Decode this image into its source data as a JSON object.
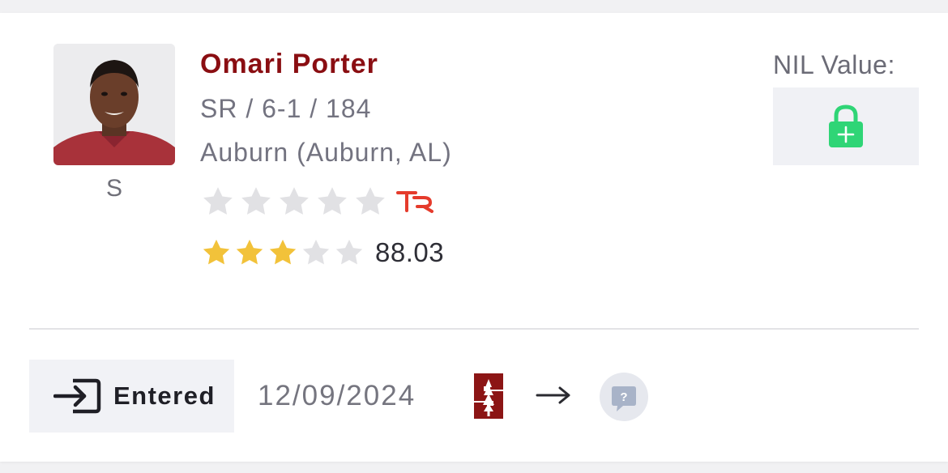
{
  "player": {
    "name": "Omari Porter",
    "class_height_weight": "SR / 6-1 / 184",
    "school": "Auburn (Auburn, AL)",
    "position": "S",
    "photo_icon": "player-headshot"
  },
  "ratings": {
    "tr_stars": {
      "filled": 0,
      "total": 5,
      "logo_text": "TR"
    },
    "composite": {
      "stars_filled": 3,
      "total": 5,
      "value": "88.03"
    },
    "colors": {
      "star_filled": "#f2c23a",
      "star_empty": "#e1e1e4",
      "tr_logo": "#e53b2c"
    }
  },
  "nil": {
    "label": "NIL Value:",
    "icon": "lock-plus-icon",
    "icon_color": "#2fd576"
  },
  "transfer": {
    "status_label": "Entered",
    "status_icon": "enter-icon",
    "date": "12/09/2024",
    "from_logo": "stanford-logo",
    "to_logo": "unknown-school-icon",
    "arrow_icon": "right-arrow-icon"
  },
  "colors": {
    "name": "#8a0e12",
    "stanford": "#8c1515"
  }
}
